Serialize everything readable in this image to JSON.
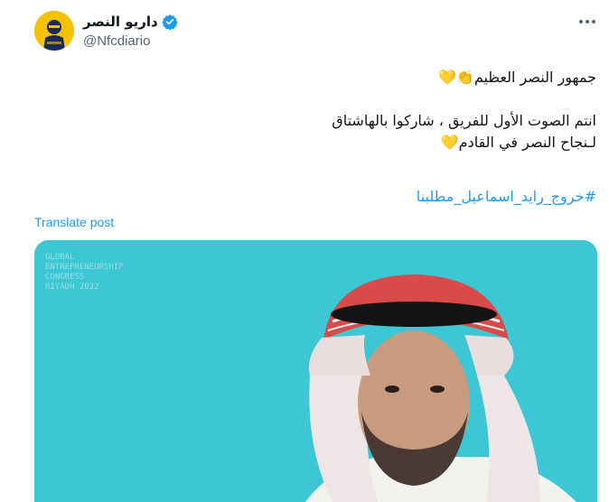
{
  "tweet": {
    "display_name": "داريو النصر",
    "handle": "@Nfcdiario",
    "line1": "جمهور النصر العظيم👏💛",
    "line2": "انتم الصوت الأول للفريق ، شاركوا بالهاشتاق",
    "line3": "لـنجاح النصر في القادم💛",
    "hashtag": "#خروج_رايد_اسماعيل_مطلبنا",
    "translate_label": "Translate post"
  },
  "media": {
    "watermark_lines": [
      "GLOBAL",
      "ENTREPRENEURSHIP",
      "CONGRESS",
      "RIYADH 2022"
    ]
  },
  "icons": {
    "verified": "verified-badge-icon",
    "more": "more-options-icon"
  },
  "colors": {
    "accent": "#1d9bf0",
    "media_bg": "#3dc7d4",
    "avatar_bg": "#f5c200"
  }
}
